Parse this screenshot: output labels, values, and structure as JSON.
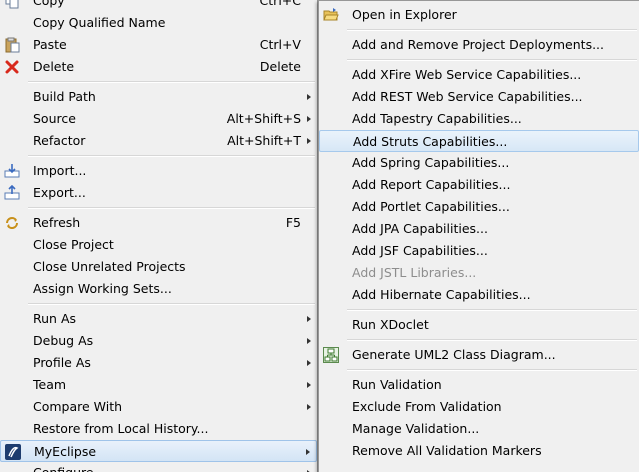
{
  "main_menu": {
    "items": [
      {
        "label": "Copy",
        "shortcut": "Ctrl+C"
      },
      {
        "label": "Copy Qualified Name",
        "shortcut": ""
      },
      {
        "label": "Paste",
        "shortcut": "Ctrl+V"
      },
      {
        "label": "Delete",
        "shortcut": "Delete"
      },
      {
        "label": "Build Path",
        "shortcut": ""
      },
      {
        "label": "Source",
        "shortcut": "Alt+Shift+S"
      },
      {
        "label": "Refactor",
        "shortcut": "Alt+Shift+T"
      },
      {
        "label": "Import...",
        "shortcut": ""
      },
      {
        "label": "Export...",
        "shortcut": ""
      },
      {
        "label": "Refresh",
        "shortcut": "F5"
      },
      {
        "label": "Close Project",
        "shortcut": ""
      },
      {
        "label": "Close Unrelated Projects",
        "shortcut": ""
      },
      {
        "label": "Assign Working Sets...",
        "shortcut": ""
      },
      {
        "label": "Run As",
        "shortcut": ""
      },
      {
        "label": "Debug As",
        "shortcut": ""
      },
      {
        "label": "Profile As",
        "shortcut": ""
      },
      {
        "label": "Team",
        "shortcut": ""
      },
      {
        "label": "Compare With",
        "shortcut": ""
      },
      {
        "label": "Restore from Local History...",
        "shortcut": ""
      },
      {
        "label": "MyEclipse",
        "shortcut": ""
      },
      {
        "label": "Configure",
        "shortcut": ""
      }
    ]
  },
  "sub_menu": {
    "items": [
      {
        "label": "Open in Explorer"
      },
      {
        "label": "Add and Remove Project Deployments..."
      },
      {
        "label": "Add XFire Web Service Capabilities..."
      },
      {
        "label": "Add REST Web Service Capabilities..."
      },
      {
        "label": "Add Tapestry Capabilities..."
      },
      {
        "label": "Add Struts Capabilities..."
      },
      {
        "label": "Add Spring Capabilities..."
      },
      {
        "label": "Add Report Capabilities..."
      },
      {
        "label": "Add Portlet Capabilities..."
      },
      {
        "label": "Add JPA Capabilities..."
      },
      {
        "label": "Add JSF Capabilities..."
      },
      {
        "label": "Add JSTL Libraries..."
      },
      {
        "label": "Add Hibernate Capabilities..."
      },
      {
        "label": "Run XDoclet"
      },
      {
        "label": "Generate UML2 Class Diagram..."
      },
      {
        "label": "Run Validation"
      },
      {
        "label": "Exclude From Validation"
      },
      {
        "label": "Manage Validation..."
      },
      {
        "label": "Remove All Validation Markers"
      }
    ]
  },
  "colors": {
    "menu_background": "#f0f0f0",
    "highlight_border": "#a6c9ec",
    "disabled_text": "#8d8d8d",
    "delete_icon_red": "#d8291c",
    "myeclipse_icon_bg": "#1d3c6e"
  }
}
